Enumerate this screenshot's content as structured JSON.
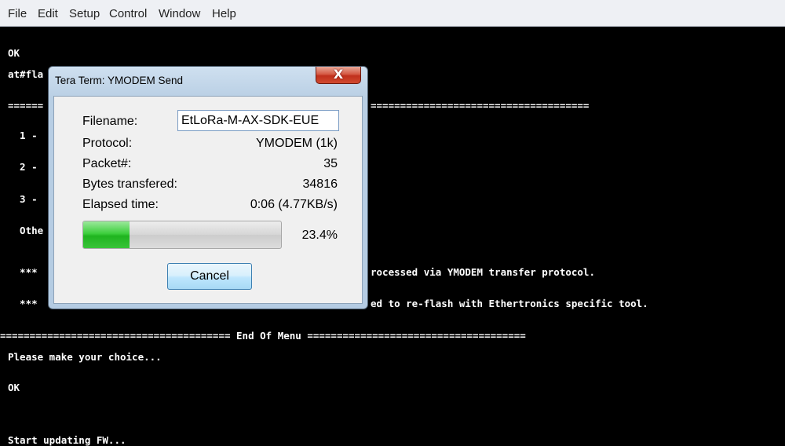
{
  "menu": [
    "File",
    "Edit",
    "Setup",
    "Control",
    "Window",
    "Help"
  ],
  "terminal": {
    "lines": [
      "OK",
      "at#fla",
      "======",
      "  1 -",
      "  2 -",
      "  3 -",
      "  Othe",
      "  ***",
      "  ***",
      "======================================= End Of Menu =====================================",
      "Please make your choice...",
      "OK",
      "Start updating FW..."
    ],
    "right_separator": "=====================================",
    "right_fragment_1": "rocessed via YMODEM transfer protocol.",
    "right_fragment_2": "ed to re-flash with Ethertronics specific tool."
  },
  "dialog": {
    "title": "Tera Term: YMODEM Send",
    "close_glyph": "X",
    "filename_label": "Filename:",
    "filename_value": "EtLoRa-M-AX-SDK-EUE",
    "protocol_label": "Protocol:",
    "protocol_value": "YMODEM (1k)",
    "packet_label": "Packet#:",
    "packet_value": "35",
    "bytes_label": "Bytes transfered:",
    "bytes_value": "34816",
    "elapsed_label": "Elapsed time:",
    "elapsed_value": "0:06 (4.77KB/s)",
    "progress_percent_text": "23.4%",
    "progress_fraction": 0.234,
    "cancel_label": "Cancel"
  },
  "colors": {
    "terminal_bg": "#000000",
    "terminal_fg": "#ffffff",
    "progress_green": "#2fc02f",
    "close_red": "#c7402a"
  },
  "icons": [
    "close-icon"
  ]
}
